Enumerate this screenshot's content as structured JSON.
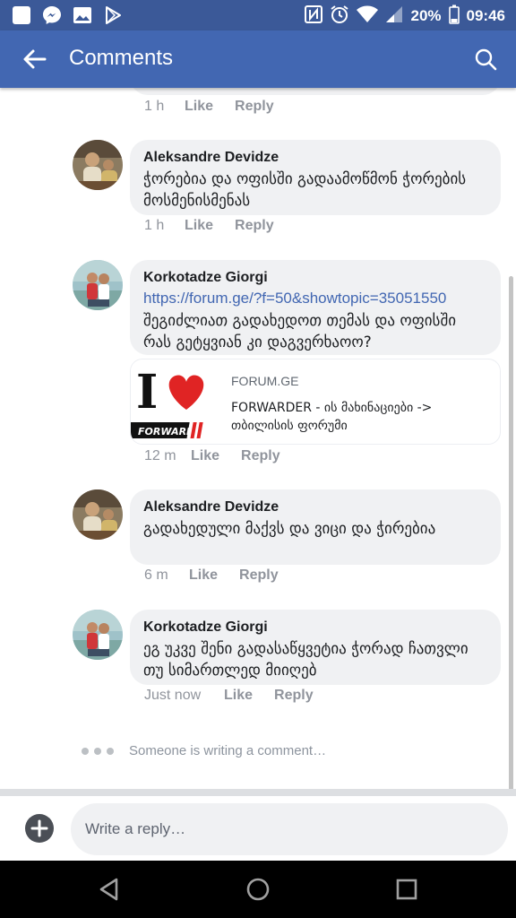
{
  "status_bar": {
    "battery": "20%",
    "time": "09:46",
    "left_icons": [
      "square-app-icon",
      "messenger-icon",
      "gallery-icon",
      "play-store-icon"
    ],
    "right_icons": [
      "nfc-icon",
      "alarm-icon",
      "wifi-icon",
      "signal-icon",
      "battery-icon"
    ]
  },
  "app_bar": {
    "title": "Comments"
  },
  "comments": [
    {
      "author": "",
      "text": "",
      "time": "1 h",
      "like_label": "Like",
      "reply_label": "Reply"
    },
    {
      "author": "Aleksandre Devidze",
      "text": "ჭორებია და ოფისში გადაამოწმონ ჭორების მოსმენისმენას",
      "time": "1 h",
      "like_label": "Like",
      "reply_label": "Reply"
    },
    {
      "author": "Korkotadze Giorgi",
      "link": "https://forum.ge/?f=50&showtopic=35051550",
      "text": "შეგიძლიათ გადახედოთ თემას და ოფისში რას გეტყვიან კი დაგვერხაოო?",
      "link_preview": {
        "domain": "FORUM.GE",
        "title": "FORWARDER - ის მახინაციები -> თბილისის ფორუმი",
        "thumb_letter": "I",
        "thumb_caption": "FORWARDER"
      },
      "time": "12 m",
      "like_label": "Like",
      "reply_label": "Reply"
    },
    {
      "author": "Aleksandre Devidze",
      "text": "გადახედული მაქვს და ვიცი და ჭირებია",
      "time": "6 m",
      "like_label": "Like",
      "reply_label": "Reply"
    },
    {
      "author": "Korkotadze Giorgi",
      "text": "ეგ უკვე შენი გადასაწყვეტია ჭორად ჩათვლი თუ სიმართლედ მიიღებ",
      "time": "Just now",
      "like_label": "Like",
      "reply_label": "Reply"
    }
  ],
  "typing_indicator": "Someone is writing a comment…",
  "composer": {
    "placeholder": "Write a reply…"
  },
  "colors": {
    "status_bar": "#3b5998",
    "app_bar": "#4267b2",
    "bubble": "#f0f1f3",
    "link": "#4267b2",
    "meta": "#90949c"
  }
}
